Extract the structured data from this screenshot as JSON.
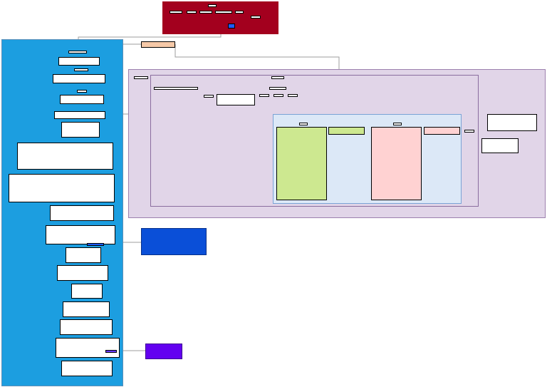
{
  "diagram": {
    "type": "tree-of-trees",
    "labels_legible": false,
    "colors": {
      "top_cluster": "#a3001e",
      "left_panel": "#1c9ee0",
      "right_panel": "#e1d5e8",
      "inner_panel": "#dce8f7",
      "green_block": "#cde890",
      "red_block": "#ffd2d2",
      "blue_box": "#0a4fd8",
      "violet_box": "#6300f0",
      "peach_node": "#f6c9a8",
      "edge": "#9e9e9e",
      "border": "#000000"
    }
  }
}
